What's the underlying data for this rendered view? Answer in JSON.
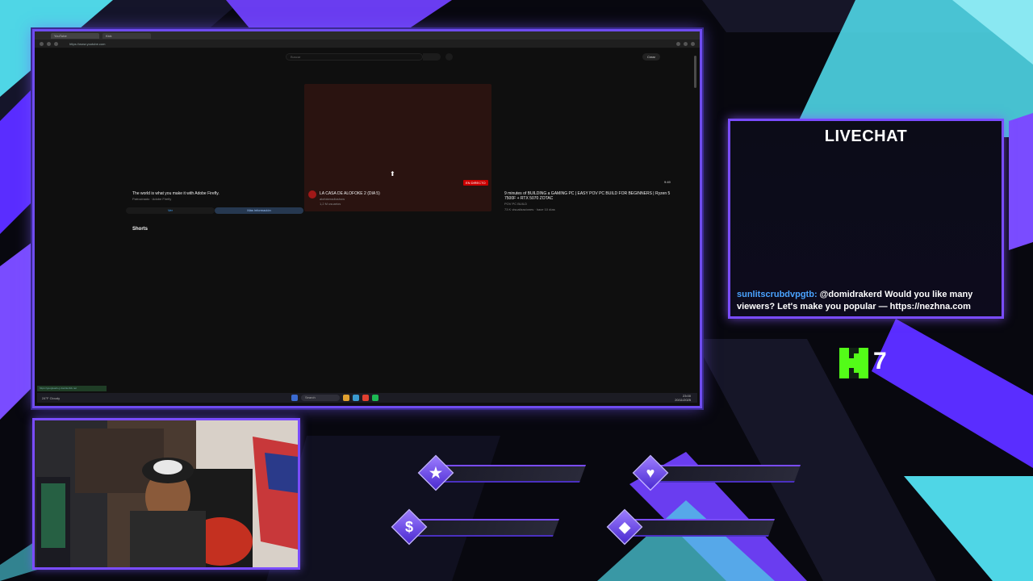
{
  "browser": {
    "tabs": [
      "YouTube",
      "Kick"
    ],
    "url": "https://www.youtube.com",
    "search_placeholder": "Buscar",
    "create_label": "Crear",
    "hover_url": "https://googleads.g.doubleclick.net"
  },
  "youtube": {
    "ad": {
      "title": "The world is what you make it with Adobe Firefly.",
      "sponsor": "Patrocinado · Adobe Firefly",
      "watch_label": "Ver",
      "more_label": "Más información"
    },
    "live_video": {
      "title": "LA CASA DE ALOFOKE 2 (DIA 5)",
      "channel": "alofokeradioshow",
      "viewers": "1,2 M usuarios",
      "live_badge": "EN DIRECTO"
    },
    "video": {
      "title_line1": "9 minutes of BUILDING a GAMING PC | EASY POV PC BUILD FOR BEGINNERS | Ryzen 5",
      "title_line2": "7500F + RTX 5070 ZOTAC",
      "channel": "POV PC BUILD",
      "stats": "73 K visualizaciones · hace 10 días",
      "duration": "9:49"
    },
    "shorts_label": "Shorts"
  },
  "taskbar": {
    "weather_temp": "24°F",
    "weather_desc": "Cloudy",
    "search_label": "Search",
    "time": "23:00",
    "date": "20/11/2025"
  },
  "livechat": {
    "title": "LIVECHAT",
    "message_user": "sunlitscrubdvpgtb:",
    "message_text": " @domidrakerd Would you like many viewers? Let's make you popular — https://nezhna.com"
  },
  "kick": {
    "count": "7"
  },
  "alerts": {
    "icons": [
      "star-icon",
      "heart-icon",
      "dollar-icon",
      "diamond-icon"
    ],
    "symbols": [
      "★",
      "♥",
      "$",
      "◆"
    ]
  },
  "colors": {
    "accent": "#7a4cff",
    "cyan": "#4fd6e6",
    "kick_green": "#53fc18",
    "live_red": "#cc0000",
    "chat_user": "#4aa3ff"
  }
}
